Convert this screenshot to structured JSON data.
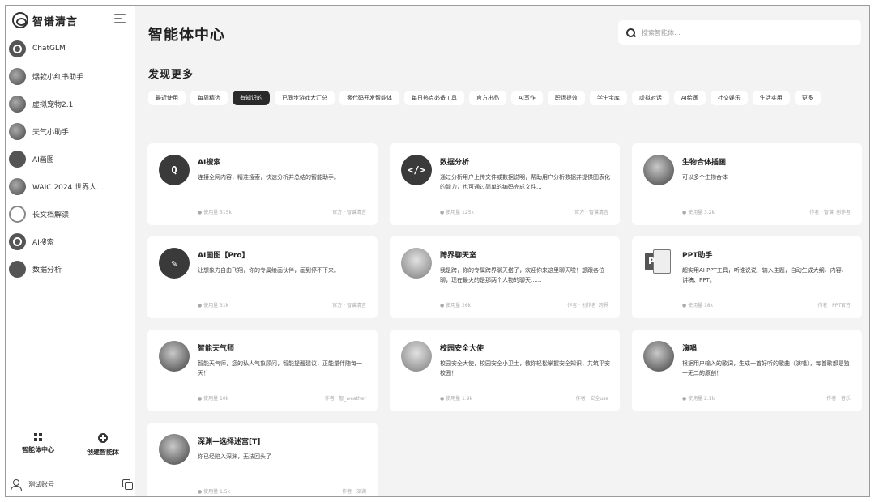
{
  "brand": {
    "name": "智谱清言"
  },
  "sidebar": {
    "items": [
      {
        "label": "ChatGLM",
        "avatar": "ring"
      },
      {
        "label": "爆款小红书助手",
        "avatar": "photo"
      },
      {
        "label": "虚拟宠物2.1",
        "avatar": "photo"
      },
      {
        "label": "天气小助手",
        "avatar": "photo"
      },
      {
        "label": "AI画图",
        "avatar": "dark"
      },
      {
        "label": "WAIC 2024 世界人...",
        "avatar": "photo"
      },
      {
        "label": "长文档解读",
        "avatar": "light"
      },
      {
        "label": "AI搜索",
        "avatar": "ring"
      },
      {
        "label": "数据分析",
        "avatar": "dark"
      }
    ],
    "bottom": {
      "agent_center": "智能体中心",
      "create_agent": "创建智能体"
    },
    "account": {
      "label": "测试账号"
    }
  },
  "main": {
    "title": "智能体中心",
    "search": {
      "placeholder": "搜索智能体..."
    },
    "section_title": "发现更多",
    "tabs": [
      {
        "label": "最近使用",
        "active": false
      },
      {
        "label": "每周精选",
        "active": false
      },
      {
        "label": "有知识的",
        "active": true
      },
      {
        "label": "已同步游戏大汇总",
        "active": false
      },
      {
        "label": "零代码开发智能体",
        "active": false
      },
      {
        "label": "每日热点必备工具",
        "active": false
      },
      {
        "label": "官方出品",
        "active": false
      },
      {
        "label": "AI写作",
        "active": false
      },
      {
        "label": "职场提效",
        "active": false
      },
      {
        "label": "学生宝库",
        "active": false
      },
      {
        "label": "虚拟对话",
        "active": false
      },
      {
        "label": "AI绘画",
        "active": false
      },
      {
        "label": "社交娱乐",
        "active": false
      },
      {
        "label": "生活实用",
        "active": false
      },
      {
        "label": "更多",
        "active": false
      }
    ],
    "cards": [
      {
        "name": "AI搜索",
        "desc": "连接全网内容，精准搜索，快速分析并总结的智能助手。",
        "avatar": "dark",
        "glyph": "Q",
        "author": "● 使用量 515k",
        "tag": "官方 · 智谱清言"
      },
      {
        "name": "数据分析",
        "desc": "通过分析用户上传文件或数据说明，帮助用户分析数据并提供图表化的能力，也可通过简单的编码完成文件...",
        "avatar": "dark",
        "glyph": "</>",
        "author": "● 使用量 125k",
        "tag": "官方 · 智谱清言"
      },
      {
        "name": "生物合体插画",
        "desc": "可以多个生物合体",
        "avatar": "photo",
        "glyph": "",
        "author": "● 使用量 3.2k",
        "tag": "作者 · 智谱_创作者"
      },
      {
        "name": "AI画图【Pro】",
        "desc": "让想象力自由飞翔，你的专属绘画伙伴，画到停不下来。",
        "avatar": "dark",
        "glyph": "✎",
        "author": "● 使用量 31k",
        "tag": "官方 · 智谱清言"
      },
      {
        "name": "跨界聊天室",
        "desc": "我是跨，你的专属跨界聊天搭子，欢迎你来这里聊天啦！想跟各位聊，现在最火的是那两个人物的聊天......",
        "avatar": "light",
        "glyph": "",
        "author": "● 使用量 26k",
        "tag": "作者 · 创作者_跨界"
      },
      {
        "name": "PPT助手",
        "desc": "超实用AI PPT工具，听谁说说，输入主题，自动生成大纲、内容、讲稿、PPT。",
        "avatar": "ppt",
        "glyph": "",
        "author": "● 使用量 18k",
        "tag": "作者 · PPT官方"
      },
      {
        "name": "智能天气师",
        "desc": "智能天气师，您的私人气象顾问，智能提醒建议，正能量伴随每一天！",
        "avatar": "photo",
        "glyph": "",
        "author": "● 使用量 10k",
        "tag": "作者 · 智_weather"
      },
      {
        "name": "校园安全大使",
        "desc": "校园安全大使，校园安全小卫士，教你轻松掌握安全知识，共筑平安校园！",
        "avatar": "light",
        "glyph": "",
        "author": "● 使用量 1.9k",
        "tag": "作者 · 安全use"
      },
      {
        "name": "演唱",
        "desc": "根据用户输入的歌词，生成一首好听的歌曲（演唱），每首歌都是独一无二的原创！",
        "avatar": "photo",
        "glyph": "",
        "author": "● 使用量 2.1k",
        "tag": "作者 · 音乐"
      },
      {
        "name": "深渊—选择迷宫[T]",
        "desc": "你已经陷入深渊，无法回头了",
        "avatar": "photo",
        "glyph": "",
        "author": "● 使用量 1.5k",
        "tag": "作者 · 深渊"
      }
    ]
  }
}
